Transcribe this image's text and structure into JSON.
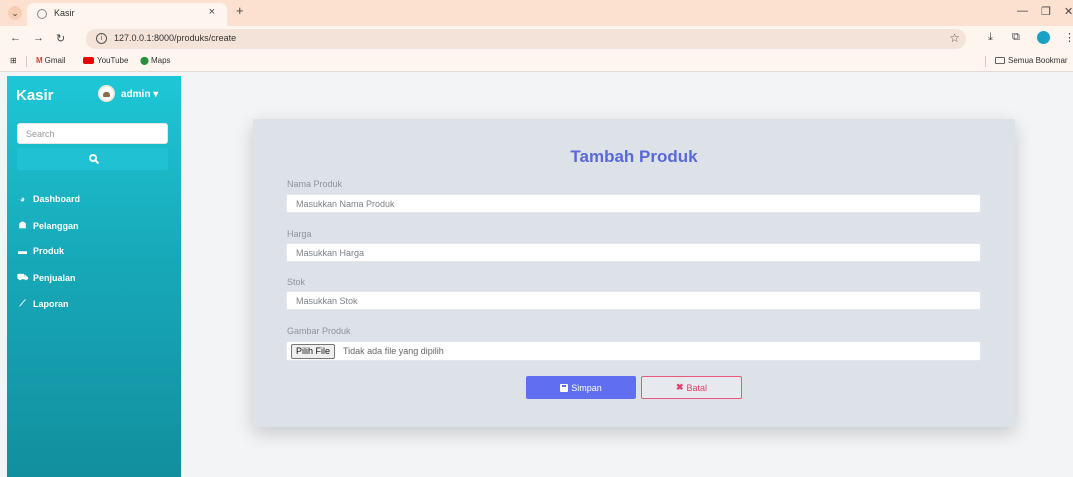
{
  "browser": {
    "tab_title": "Kasir",
    "tab_close": "×",
    "new_tab": "+",
    "url": "127.0.0.1:8000/produks/create",
    "bookmarks": [
      "Gmail",
      "YouTube",
      "Maps"
    ],
    "bookmarks_folder": "Semua Bookmar"
  },
  "sidebar": {
    "brand": "Kasir",
    "user": "admin ▾",
    "search_placeholder": "Search",
    "items": [
      {
        "label": "Dashboard",
        "icon": "dashboard-icon"
      },
      {
        "label": "Pelanggan",
        "icon": "users-icon"
      },
      {
        "label": "Produk",
        "icon": "box-icon"
      },
      {
        "label": "Penjualan",
        "icon": "cart-icon"
      },
      {
        "label": "Laporan",
        "icon": "chart-icon"
      }
    ]
  },
  "form": {
    "title": "Tambah Produk",
    "fields": [
      {
        "label": "Nama Produk",
        "placeholder": "Masukkan Nama Produk"
      },
      {
        "label": "Harga",
        "placeholder": "Masukkan Harga"
      },
      {
        "label": "Stok",
        "placeholder": "Masukkan Stok"
      }
    ],
    "image_label": "Gambar Produk",
    "file_button": "Pilih File",
    "file_status": "Tidak ada file yang dipilih",
    "save_label": "Simpan",
    "cancel_label": "Batal"
  },
  "colors": {
    "accent": "#5f6ff0",
    "sidebar": "#17a9b9",
    "danger": "#e0416a",
    "title": "#5a68d9"
  }
}
